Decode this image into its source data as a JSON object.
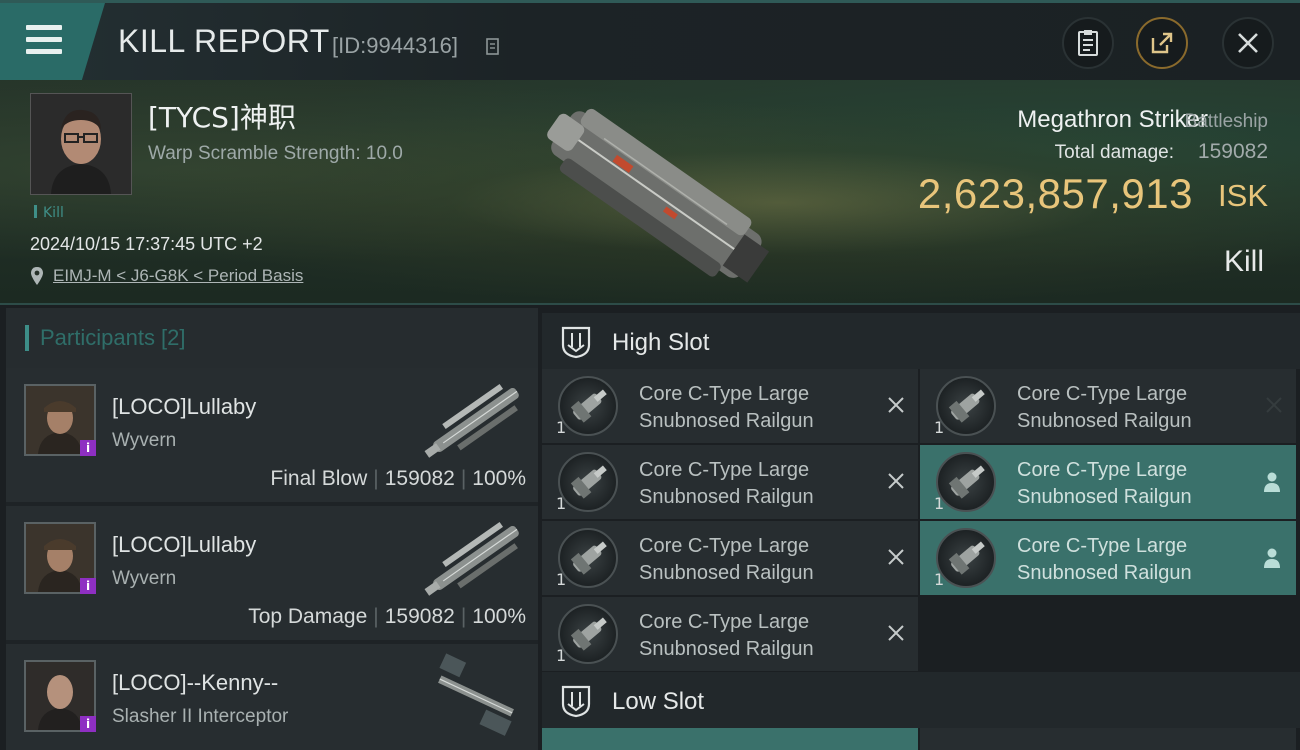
{
  "header": {
    "title": "KILL REPORT",
    "report_id": "[ID:9944316]",
    "buttons": [
      "clipboard-icon",
      "share-icon",
      "close-icon"
    ]
  },
  "victim": {
    "name": "[TYCS]神职",
    "warp_scramble": "Warp Scramble Strength: 10.0",
    "tag": "Kill",
    "datetime": "2024/10/15 17:37:45 UTC +2",
    "location": "EIMJ-M < J6-G8K < Period Basis",
    "ship_name": "Megathron Striker",
    "ship_class": "Battleship",
    "total_damage_label": "Total damage:",
    "total_damage": "159082",
    "isk_value": "2,623,857,913",
    "isk_unit": "ISK",
    "result": "Kill"
  },
  "participants": {
    "title": "Participants [2]",
    "rows": [
      {
        "name": "[LOCO]Lullaby",
        "ship": "Wyvern",
        "role": "Final Blow",
        "damage": "159082",
        "percent": "100%"
      },
      {
        "name": "[LOCO]Lullaby",
        "ship": "Wyvern",
        "role": "Top Damage",
        "damage": "159082",
        "percent": "100%"
      },
      {
        "name": "[LOCO]--Kenny--",
        "ship": "Slasher II Interceptor",
        "role": "",
        "damage": "",
        "percent": ""
      }
    ]
  },
  "slots": {
    "high_title": "High Slot",
    "low_title": "Low Slot",
    "high_items": [
      {
        "line1": "Core C-Type Large",
        "line2": "Snubnosed Railgun",
        "qty": "1",
        "state": "destroyed"
      },
      {
        "line1": "Core C-Type Large",
        "line2": "Snubnosed Railgun",
        "qty": "1",
        "state": "destroyed"
      },
      {
        "line1": "Core C-Type Large",
        "line2": "Snubnosed Railgun",
        "qty": "1",
        "state": "destroyed"
      },
      {
        "line1": "Core C-Type Large",
        "line2": "Snubnosed Railgun",
        "qty": "1",
        "state": "dropped"
      },
      {
        "line1": "Core C-Type Large",
        "line2": "Snubnosed Railgun",
        "qty": "1",
        "state": "destroyed"
      },
      {
        "line1": "Core C-Type Large",
        "line2": "Snubnosed Railgun",
        "qty": "1",
        "state": "dropped"
      },
      {
        "line1": "Core C-Type Large",
        "line2": "Snubnosed Railgun",
        "qty": "1",
        "state": "destroyed"
      }
    ]
  },
  "colors": {
    "accent_teal": "#3d8e88",
    "isk_gold": "#e8c57b",
    "dropped_bg": "#3a716b",
    "info_badge": "#8e2fc2"
  }
}
